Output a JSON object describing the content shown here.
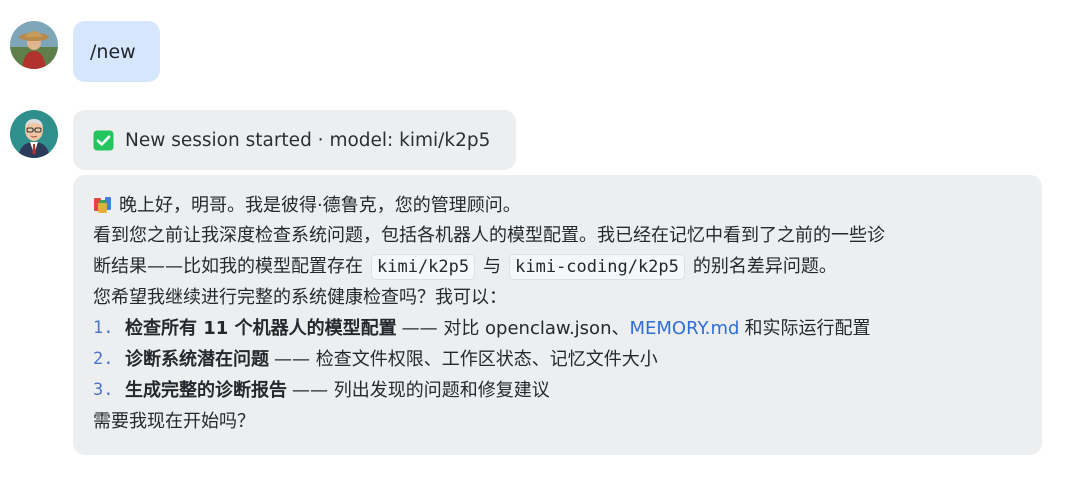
{
  "messages": {
    "user": {
      "text": "/new"
    },
    "system": {
      "text": "New session started · model: kimi/k2p5",
      "icon": "check-mark-button-icon",
      "icon_color": "#22c55e"
    },
    "assistant": {
      "greeting_icon": "books-icon",
      "greeting": "晚上好，明哥。我是彼得·德鲁克，您的管理顾问。",
      "para1_line1": "看到您之前让我深度检查系统问题，包括各机器人的模型配置。我已经在记忆中看到了之前的一些诊",
      "para1_line2_a": "断结果——比如我的模型配置存在",
      "code1": "kimi/k2p5",
      "para1_line2_b": "与",
      "code2": "kimi-coding/k2p5",
      "para1_line2_c": "的别名差异问题。",
      "para2": "您希望我继续进行完整的系统健康检查吗？我可以：",
      "list": [
        {
          "num": "1.",
          "bold": "检查所有 11 个机器人的模型配置",
          "rest_a": "—— 对比 openclaw.json、",
          "link": "MEMORY.md",
          "rest_b": "和实际运行配置"
        },
        {
          "num": "2.",
          "bold": "诊断系统潜在问题",
          "rest_a": "—— 检查文件权限、工作区状态、记忆文件大小"
        },
        {
          "num": "3.",
          "bold": "生成完整的诊断报告",
          "rest_a": "—— 列出发现的问题和修复建议"
        }
      ],
      "closing": "需要我现在开始吗？"
    }
  },
  "colors": {
    "user_bubble": "#d6e6fd",
    "assistant_bubble": "#edeef0",
    "link": "#2f6fd6",
    "list_number": "#4a74c9"
  }
}
